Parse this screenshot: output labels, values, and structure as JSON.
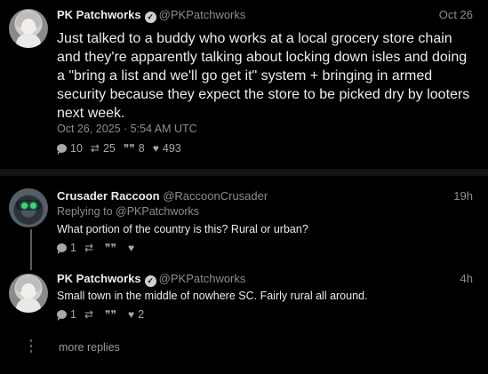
{
  "posts": [
    {
      "name": "PK Patchworks",
      "handle": "@PKPatchworks",
      "time": "Oct 26",
      "text": "Just talked to a buddy who works at a local grocery store chain and they're apparently talking about locking down  isles and doing a \"bring a list and we'll go get it\" system + bringing in armed security because they expect the store to be picked dry by looters next week.",
      "meta": "Oct 26, 2025 · 5:54 AM UTC",
      "replies": "10",
      "reposts": "25",
      "quotes": "8",
      "likes": "493"
    },
    {
      "name": "Crusader Raccoon",
      "handle": "@RaccoonCrusader",
      "time": "19h",
      "replying": "Replying to @PKPatchworks",
      "text": "What portion of the country is this? Rural or urban?",
      "replies": "1",
      "reposts": "",
      "quotes": "",
      "likes": ""
    },
    {
      "name": "PK Patchworks",
      "handle": "@PKPatchworks",
      "time": "4h",
      "text": "Small town in the middle of nowhere SC. Fairly rural all around.",
      "replies": "1",
      "reposts": "",
      "quotes": "",
      "likes": "2"
    }
  ],
  "more_replies": "more replies",
  "icons": {
    "verified": "verified-check-icon",
    "reply": "reply-bubble-icon",
    "repost": "repost-icon",
    "quote": "quote-icon",
    "like": "heart-icon"
  }
}
